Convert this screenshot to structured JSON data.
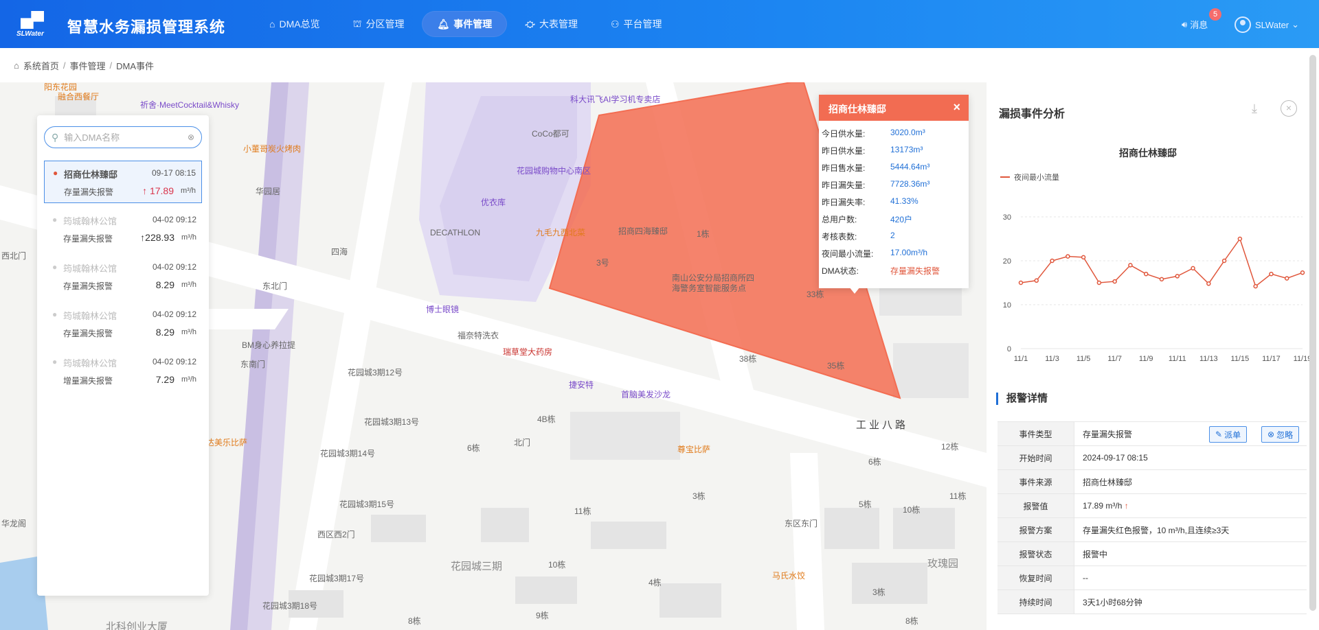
{
  "header": {
    "logo_text": "SLWater",
    "title": "智慧水务漏损管理系统",
    "nav": [
      {
        "label": "DMA总览",
        "icon": "home-icon",
        "active": false
      },
      {
        "label": "分区管理",
        "icon": "partition-icon",
        "active": false
      },
      {
        "label": "事件管理",
        "icon": "bell-icon",
        "active": true
      },
      {
        "label": "大表管理",
        "icon": "meter-icon",
        "active": false
      },
      {
        "label": "平台管理",
        "icon": "platform-icon",
        "active": false
      }
    ],
    "messages_label": "消息",
    "messages_count": "5",
    "user_name": "SLWater"
  },
  "breadcrumb": [
    "系统首页",
    "事件管理",
    "DMA事件"
  ],
  "dma_list": {
    "search_placeholder": "输入DMA名称",
    "items": [
      {
        "name": "招商仕林臻邸",
        "time": "09-17 08:15",
        "type": "存量漏失报警",
        "arrow": "↑",
        "value": "17.89",
        "unit": "m³/h",
        "selected": true
      },
      {
        "name": "筠城翰林公馆",
        "time": "04-02 09:12",
        "type": "存量漏失报警",
        "arrow": "↑",
        "value": "228.93",
        "unit": "m³/h",
        "selected": false
      },
      {
        "name": "筠城翰林公馆",
        "time": "04-02 09:12",
        "type": "存量漏失报警",
        "arrow": "",
        "value": "8.29",
        "unit": "m³/h",
        "selected": false
      },
      {
        "name": "筠城翰林公馆",
        "time": "04-02 09:12",
        "type": "存量漏失报警",
        "arrow": "",
        "value": "8.29",
        "unit": "m³/h",
        "selected": false
      },
      {
        "name": "筠城翰林公馆",
        "time": "04-02 09:12",
        "type": "增量漏失报警",
        "arrow": "",
        "value": "7.29",
        "unit": "m³/h",
        "selected": false
      }
    ]
  },
  "popup": {
    "title": "招商仕林臻邸",
    "rows": [
      {
        "k": "今日供水量:",
        "v": "3020.0m³"
      },
      {
        "k": "昨日供水量:",
        "v": "13173m³"
      },
      {
        "k": "昨日售水量:",
        "v": "5444.64m³"
      },
      {
        "k": "昨日漏失量:",
        "v": "7728.36m³"
      },
      {
        "k": "昨日漏失率:",
        "v": "41.33%"
      },
      {
        "k": "总用户数:",
        "v": "420户"
      },
      {
        "k": "考核表数:",
        "v": "2"
      },
      {
        "k": "夜间最小流量:",
        "v": "17.00m³/h"
      },
      {
        "k": "DMA状态:",
        "v": "存量漏失报警"
      }
    ]
  },
  "map_labels": {
    "roads": [
      "工业八路"
    ],
    "areas": [
      "花园城三期",
      "玫瑰园",
      "北科创业大厦"
    ],
    "places": [
      "阳东花园",
      "融合西餐厅",
      "祈舍·MeetCocktail&Whisky",
      "小董哥炭火烤肉",
      "华园居",
      "西北门",
      "四海",
      "东北门",
      "BM身心养拉提",
      "东南门",
      "达美乐比萨",
      "华龙阁",
      "科大讯飞AI学习机专卖店",
      "CoCo都可",
      "花园城购物中心南区",
      "优衣库",
      "DECATHLON",
      "九毛九西北菜",
      "招商四海臻邸",
      "南山公安分局招商所四海警务室智能服务点",
      "博士眼镜",
      "福奈特洗衣",
      "瑞草堂大药房",
      "花园城3期12号",
      "花园城3期13号",
      "花园城3期14号",
      "花园城3期15号",
      "花园城3期17号",
      "花园城3期18号",
      "捷安特",
      "首脑美发沙龙",
      "北门",
      "西区西2门",
      "尊宝比萨",
      "东区东门",
      "马氏水饺",
      "1栋",
      "3号",
      "33栋",
      "38栋",
      "35栋",
      "4B栋",
      "6栋",
      "3栋",
      "11栋",
      "10栋",
      "4栋",
      "9栋",
      "8栋",
      "12栋",
      "6栋",
      "5栋",
      "10栋",
      "11栋",
      "3栋",
      "8栋"
    ]
  },
  "right_panel": {
    "title": "漏损事件分析",
    "chart_data": {
      "type": "line",
      "title": "招商仕林臻邸",
      "legend": "夜间最小流量",
      "color": "#e0563b",
      "x": [
        "11/1",
        "11/2",
        "11/3",
        "11/4",
        "11/5",
        "11/6",
        "11/7",
        "11/8",
        "11/9",
        "11/10",
        "11/11",
        "11/12",
        "11/13",
        "11/14",
        "11/15",
        "11/16",
        "11/17",
        "11/18",
        "11/19"
      ],
      "x_tick_labels": [
        "11/1",
        "11/3",
        "11/5",
        "11/7",
        "11/9",
        "11/11",
        "11/13",
        "11/15",
        "11/17",
        "11/19"
      ],
      "values": [
        15,
        15.5,
        20,
        21,
        20.8,
        15,
        15.3,
        19,
        17,
        15.8,
        16.5,
        18.3,
        14.8,
        20,
        25,
        14.2,
        17,
        16,
        17.3
      ],
      "ylim": [
        0,
        30
      ],
      "yticks": [
        0,
        10,
        20,
        30
      ]
    },
    "alarm_title": "报警详情",
    "details": [
      {
        "k": "事件类型",
        "v": "存量漏失报警"
      },
      {
        "k": "开始时间",
        "v": "2024-09-17 08:15"
      },
      {
        "k": "事件来源",
        "v": "招商仕林臻邸"
      },
      {
        "k": "报警值",
        "v": "17.89 m³/h",
        "arrow": "↑"
      },
      {
        "k": "报警方案",
        "v": "存量漏失红色报警，10 m³/h,且连续≥3天"
      },
      {
        "k": "报警状态",
        "v": "报警中"
      },
      {
        "k": "恢复时间",
        "v": "--"
      },
      {
        "k": "持续时间",
        "v": "3天1小时68分钟"
      }
    ],
    "dispatch_label": "派单",
    "ignore_label": "忽略"
  }
}
